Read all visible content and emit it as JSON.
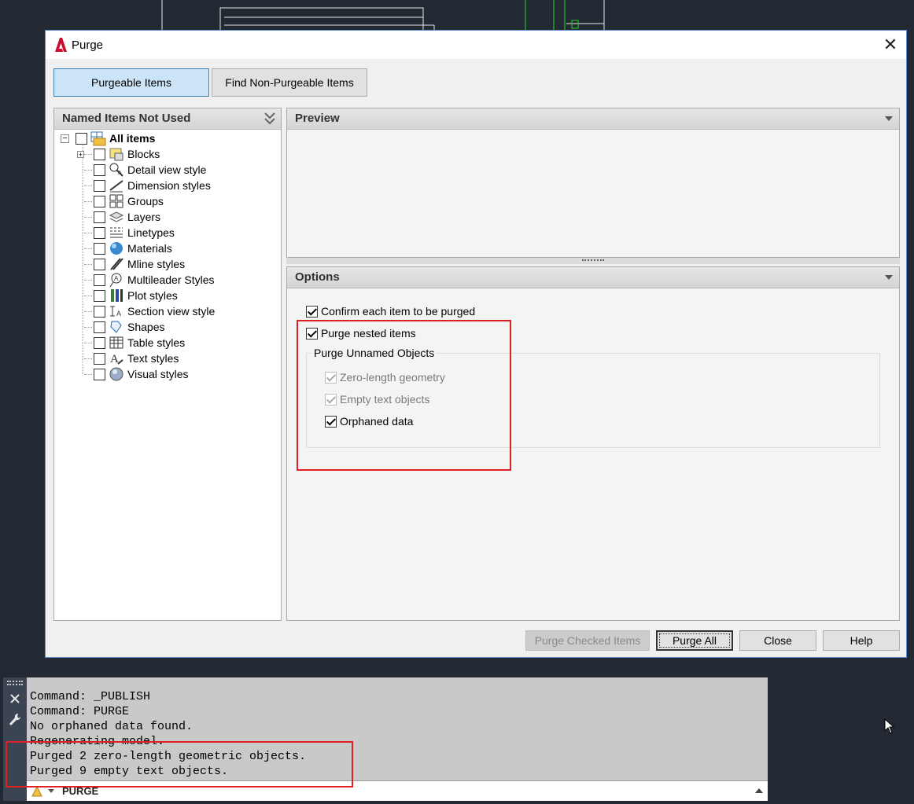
{
  "dialog": {
    "title": "Purge",
    "close_symbol": "✕",
    "tabs": [
      "Purgeable Items",
      "Find Non-Purgeable Items"
    ],
    "left_panel": {
      "header": "Named Items Not Used",
      "root": {
        "label": "All items",
        "checked": false
      },
      "items": [
        {
          "label": "Blocks",
          "icon": "blocks-icon",
          "expandable": true
        },
        {
          "label": "Detail view style",
          "icon": "detail-view-style-icon"
        },
        {
          "label": "Dimension styles",
          "icon": "dimension-styles-icon"
        },
        {
          "label": "Groups",
          "icon": "groups-icon"
        },
        {
          "label": "Layers",
          "icon": "layers-icon"
        },
        {
          "label": "Linetypes",
          "icon": "linetypes-icon"
        },
        {
          "label": "Materials",
          "icon": "materials-icon"
        },
        {
          "label": "Mline styles",
          "icon": "mline-styles-icon"
        },
        {
          "label": "Multileader Styles",
          "icon": "multileader-styles-icon"
        },
        {
          "label": "Plot styles",
          "icon": "plot-styles-icon"
        },
        {
          "label": "Section view style",
          "icon": "section-view-style-icon"
        },
        {
          "label": "Shapes",
          "icon": "shapes-icon"
        },
        {
          "label": "Table styles",
          "icon": "table-styles-icon"
        },
        {
          "label": "Text styles",
          "icon": "text-styles-icon"
        },
        {
          "label": "Visual styles",
          "icon": "visual-styles-icon"
        }
      ]
    },
    "preview": {
      "header": "Preview"
    },
    "options": {
      "header": "Options",
      "confirm_each": {
        "label": "Confirm each item to be purged",
        "checked": true
      },
      "purge_nested": {
        "label": "Purge nested items",
        "checked": true
      },
      "unnamed_group": {
        "title": "Purge Unnamed Objects",
        "zero_length": {
          "label": "Zero-length geometry",
          "checked": true,
          "enabled": false
        },
        "empty_text": {
          "label": "Empty text objects",
          "checked": true,
          "enabled": false
        },
        "orphaned": {
          "label": "Orphaned data",
          "checked": true,
          "enabled": true
        }
      }
    },
    "buttons": {
      "purge_checked": "Purge Checked Items",
      "purge_all": "Purge All",
      "close": "Close",
      "help": "Help"
    }
  },
  "command_line": {
    "history": [
      "Command: _PUBLISH",
      "Command: PURGE",
      "No orphaned data found.",
      "Regenerating model.",
      "Purged 2 zero-length geometric objects.",
      "Purged 9 empty text objects."
    ],
    "input": "PURGE"
  },
  "colors": {
    "highlight_box": "#e02020",
    "active_tab": "#cce4f7",
    "autocad_red": "#c8102e"
  }
}
